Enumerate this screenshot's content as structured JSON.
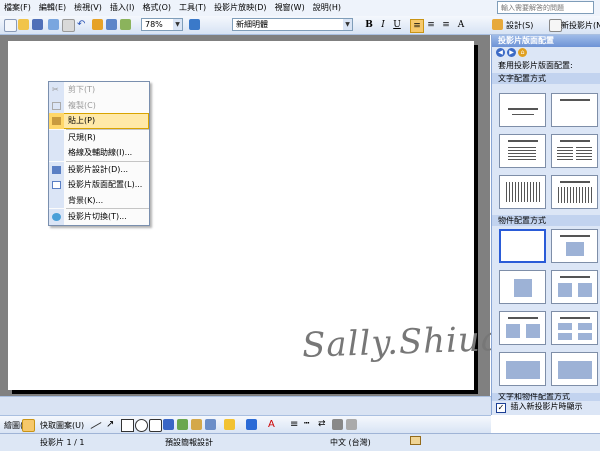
{
  "menu": {
    "items": [
      "檔案(F)",
      "編輯(E)",
      "檢視(V)",
      "插入(I)",
      "格式(O)",
      "工具(T)",
      "投影片放映(D)",
      "視窗(W)",
      "說明(H)"
    ],
    "help_placeholder": "輸入需要解答的問題"
  },
  "toolbar": {
    "zoom": "78%",
    "font_name": "新細明體",
    "bold": "B",
    "italic": "I",
    "underline": "U",
    "align_left": "≡",
    "design_label": "設計(S)",
    "new_slide_label": "新投影片(N)"
  },
  "context_menu": {
    "items": [
      {
        "label": "剪下(T)",
        "disabled": true,
        "icon": "scissors-icon"
      },
      {
        "label": "複製(C)",
        "disabled": true,
        "icon": "copy-icon"
      },
      {
        "label": "貼上(P)",
        "highlighted": true,
        "icon": "paste-icon"
      },
      {
        "label": "尺規(R)"
      },
      {
        "label": "格線及輔助線(I)..."
      },
      {
        "label": "投影片設計(D)...",
        "icon": "slide-design-icon"
      },
      {
        "label": "投影片版面配置(L)...",
        "icon": "slide-layout-icon"
      },
      {
        "label": "背景(K)..."
      },
      {
        "label": "投影片切換(T)...",
        "icon": "slide-transition-icon"
      }
    ]
  },
  "task_pane": {
    "title": "投影片版面配置",
    "subtitle": "套用投影片版面配置:",
    "text_layouts_header": "文字配置方式",
    "content_layouts_header": "物件配置方式",
    "cut_off_header": "文字和物件配置方式",
    "show_on_insert_label": "插入新投影片時顯示",
    "show_on_insert_checked": true
  },
  "drawbar": {
    "draw_label": "繪圖(R)",
    "autoshapes_label": "快取圖案(U)"
  },
  "status": {
    "slide": "投影片 1 / 1",
    "design": "預設簡報設計",
    "language": "中文 (台灣)"
  },
  "watermark": "Sally.Shiuan"
}
